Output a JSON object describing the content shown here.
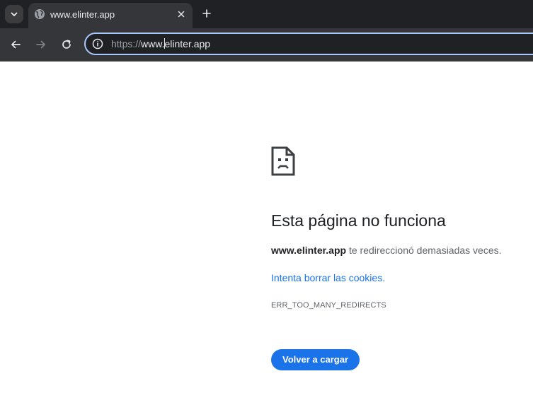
{
  "browser": {
    "tab": {
      "title": "www.elinter.app",
      "favicon_icon": "globe-icon",
      "close_icon": "close-icon"
    },
    "tab_search_icon": "chevron-down-icon",
    "new_tab_icon": "plus-icon",
    "nav": {
      "back_icon": "arrow-left-icon",
      "forward_icon": "arrow-right-icon",
      "reload_icon": "reload-icon"
    },
    "omnibox": {
      "info_icon": "info-icon",
      "scheme": "https://",
      "subdomain": "www.",
      "host": "elinter.app"
    }
  },
  "error": {
    "icon": "sad-page-icon",
    "title": "Esta página no funciona",
    "domain": "www.elinter.app",
    "message": " te redireccionó demasiadas veces.",
    "link": "Intenta borrar las cookies.",
    "code": "ERR_TOO_MANY_REDIRECTS",
    "reload_button": "Volver a cargar"
  },
  "colors": {
    "tabstrip_bg": "#202124",
    "toolbar_bg": "#35363a",
    "omnibox_border": "#a8c7fa",
    "link": "#1a73e8",
    "button_bg": "#1a73e8"
  }
}
